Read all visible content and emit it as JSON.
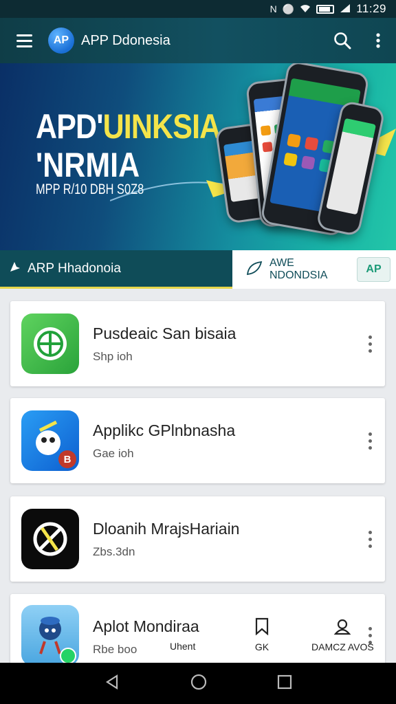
{
  "status_bar": {
    "time": "11:29"
  },
  "app_bar": {
    "title": "APP Ddonesia",
    "logo_text": "AP"
  },
  "banner": {
    "headline_part1": "APD'",
    "headline_part2": "UINKSIA",
    "headline_line2": "'NRMIA",
    "subline": "MPP R/10 DBH S0Z8"
  },
  "tabs": {
    "left_label": "ARP Hhadonoia",
    "right_label": "AWE NDONDSIA",
    "right_badge": "AP"
  },
  "cards": [
    {
      "title": "Pusdeaic San bisaia",
      "subtitle": "Shp ioh"
    },
    {
      "title": "Applikc GPlnbnasha",
      "subtitle": "Gae ioh",
      "badge": "B"
    },
    {
      "title": "Dloanih MrajsHariain",
      "subtitle": "Zbs.3dn"
    },
    {
      "title": "Aplot Mondiraa",
      "subtitle": "Rbe boo",
      "actions": [
        {
          "label": "Uhent"
        },
        {
          "label": "GK"
        },
        {
          "label": "DAMCZ AVOS"
        }
      ]
    }
  ],
  "colors": {
    "app_bar": "#125060",
    "accent_yellow": "#f4e44a",
    "teal": "#0f4c58"
  }
}
